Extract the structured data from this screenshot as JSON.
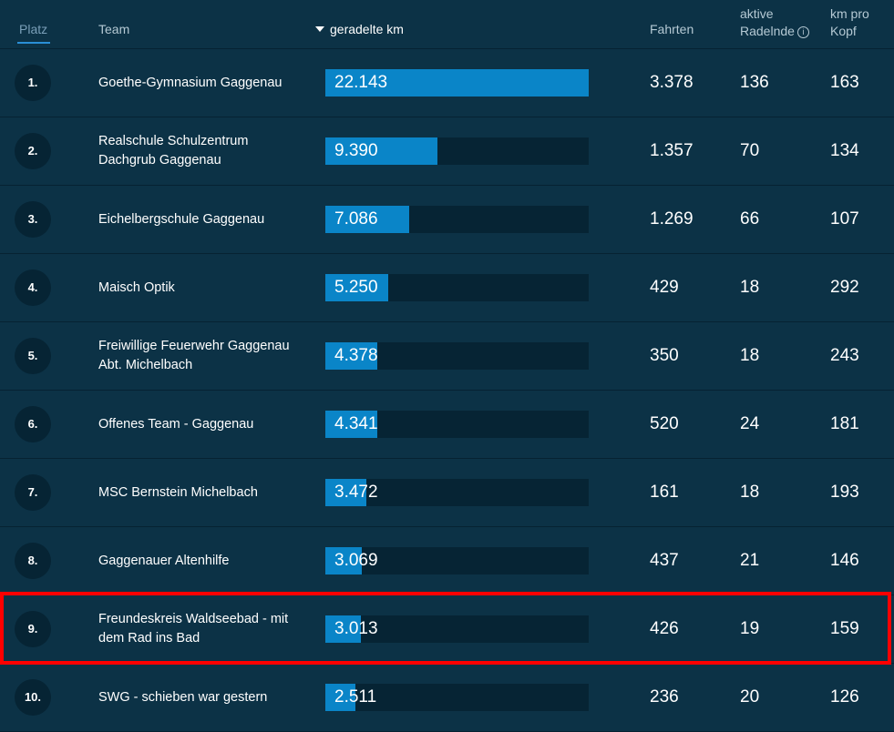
{
  "header": {
    "platz": "Platz",
    "team": "Team",
    "km": "geradelte km",
    "fahrten": "Fahrten",
    "aktive_line1": "aktive",
    "aktive_line2": "Radelnde",
    "kmpro_line1": "km pro",
    "kmpro_line2": "Kopf",
    "info_icon": "i",
    "sort_icon": "sort-descending-arrow"
  },
  "max_km": 22143,
  "rows": [
    {
      "rank": "1.",
      "team": "Goethe-Gymnasium Gaggenau",
      "km": "22.143",
      "km_value": 22143,
      "fahrten": "3.378",
      "aktive": "136",
      "kmpro": "163"
    },
    {
      "rank": "2.",
      "team": "Realschule Schulzentrum Dachgrub Gaggenau",
      "km": "9.390",
      "km_value": 9390,
      "fahrten": "1.357",
      "aktive": "70",
      "kmpro": "134"
    },
    {
      "rank": "3.",
      "team": "Eichelbergschule Gaggenau",
      "km": "7.086",
      "km_value": 7086,
      "fahrten": "1.269",
      "aktive": "66",
      "kmpro": "107"
    },
    {
      "rank": "4.",
      "team": "Maisch Optik",
      "km": "5.250",
      "km_value": 5250,
      "fahrten": "429",
      "aktive": "18",
      "kmpro": "292"
    },
    {
      "rank": "5.",
      "team": "Freiwillige Feuerwehr Gaggenau Abt. Michelbach",
      "km": "4.378",
      "km_value": 4378,
      "fahrten": "350",
      "aktive": "18",
      "kmpro": "243"
    },
    {
      "rank": "6.",
      "team": "Offenes Team - Gaggenau",
      "km": "4.341",
      "km_value": 4341,
      "fahrten": "520",
      "aktive": "24",
      "kmpro": "181"
    },
    {
      "rank": "7.",
      "team": "MSC Bernstein Michelbach",
      "km": "3.472",
      "km_value": 3472,
      "fahrten": "161",
      "aktive": "18",
      "kmpro": "193"
    },
    {
      "rank": "8.",
      "team": "Gaggenauer Altenhilfe",
      "km": "3.069",
      "km_value": 3069,
      "fahrten": "437",
      "aktive": "21",
      "kmpro": "146"
    },
    {
      "rank": "9.",
      "team": "Freundeskreis Waldseebad - mit dem Rad ins Bad",
      "km": "3.013",
      "km_value": 3013,
      "fahrten": "426",
      "aktive": "19",
      "kmpro": "159"
    },
    {
      "rank": "10.",
      "team": "SWG - schieben war gestern",
      "km": "2.511",
      "km_value": 2511,
      "fahrten": "236",
      "aktive": "20",
      "kmpro": "126"
    }
  ],
  "highlighted_rank": "9.",
  "colors": {
    "background": "#0c3246",
    "bar_fill": "#0a85c8",
    "bar_track": "#062434",
    "highlight": "#ff0000"
  }
}
